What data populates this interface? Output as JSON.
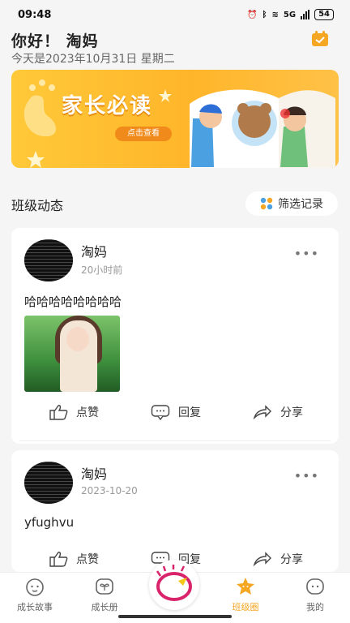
{
  "status_bar": {
    "time": "09:48",
    "network": "5G",
    "battery": "54"
  },
  "header": {
    "greeting": "你好！ 淘妈",
    "date": "今天是2023年10月31日 星期二"
  },
  "banner": {
    "title": "家长必读",
    "cta": "点击查看"
  },
  "section": {
    "title": "班级动态",
    "filter_label": "筛选记录"
  },
  "posts": [
    {
      "author": "淘妈",
      "time": "20小时前",
      "text": "哈哈哈哈哈哈哈哈",
      "like": "点赞",
      "reply": "回复",
      "share": "分享"
    },
    {
      "author": "淘妈",
      "time": "2023-10-20",
      "text": "yfughvu",
      "like": "点赞",
      "reply": "回复",
      "share": "分享"
    }
  ],
  "nav": [
    {
      "label": "成长故事"
    },
    {
      "label": "成长册"
    },
    {
      "label": "班级圈"
    },
    {
      "label": "我的"
    }
  ],
  "colors": {
    "accent": "#f5a623",
    "banner": "#ffb52a"
  }
}
